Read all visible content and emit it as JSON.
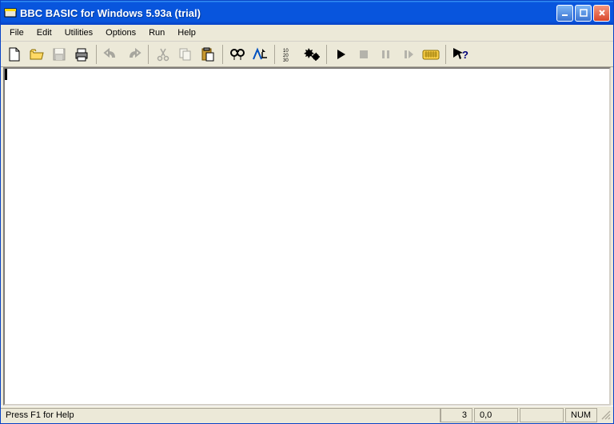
{
  "title": "BBC BASIC for Windows 5.93a (trial)",
  "menu": {
    "file": "File",
    "edit": "Edit",
    "utilities": "Utilities",
    "options": "Options",
    "run": "Run",
    "help": "Help"
  },
  "toolbar": {
    "new": "New",
    "open": "Open",
    "save": "Save",
    "print": "Print",
    "undo": "Undo",
    "redo": "Redo",
    "cut": "Cut",
    "copy": "Copy",
    "paste": "Paste",
    "find": "Find",
    "replace": "Replace",
    "renumber": "Renumber",
    "compile": "Compile",
    "run": "Run",
    "stop": "Stop",
    "pause": "Pause",
    "step": "Step",
    "immediate": "Immediate",
    "help_ctx": "Context Help"
  },
  "statusbar": {
    "help": "Press F1 for Help",
    "line": "3",
    "pos": "0,0",
    "num": "NUM"
  }
}
